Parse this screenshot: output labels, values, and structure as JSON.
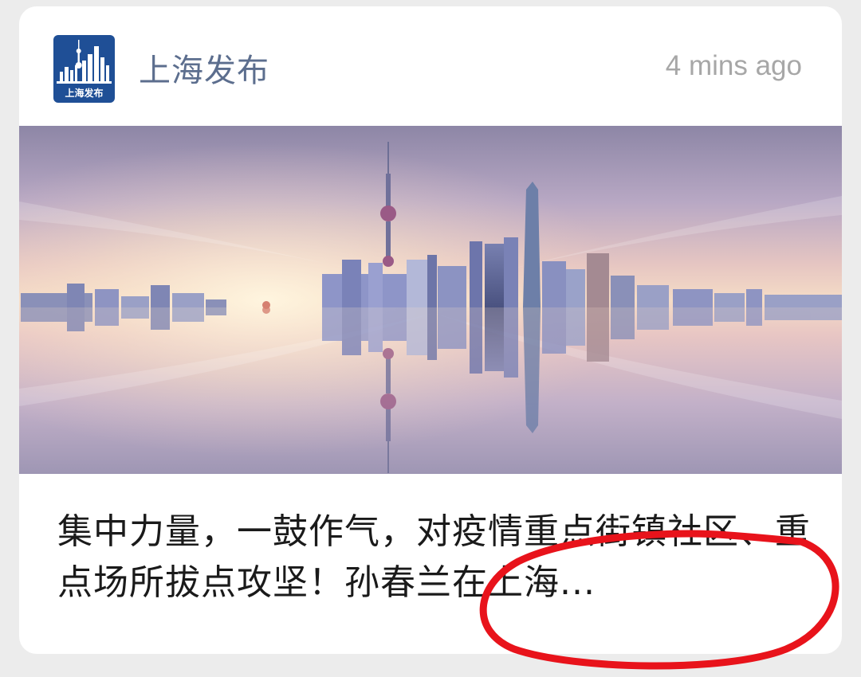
{
  "card": {
    "account_name": "上海发布",
    "avatar_text": "上海发布",
    "timestamp": "4 mins ago",
    "title": "集中力量，一鼓作气，对疫情重点街镇社区、重点场所拔点攻坚！孙春兰在上海..."
  },
  "colors": {
    "account_name": "#5c6e8e",
    "timestamp": "#a7a7a7",
    "annotation_circle": "#e8131b",
    "avatar_bg": "#1f4f96"
  }
}
